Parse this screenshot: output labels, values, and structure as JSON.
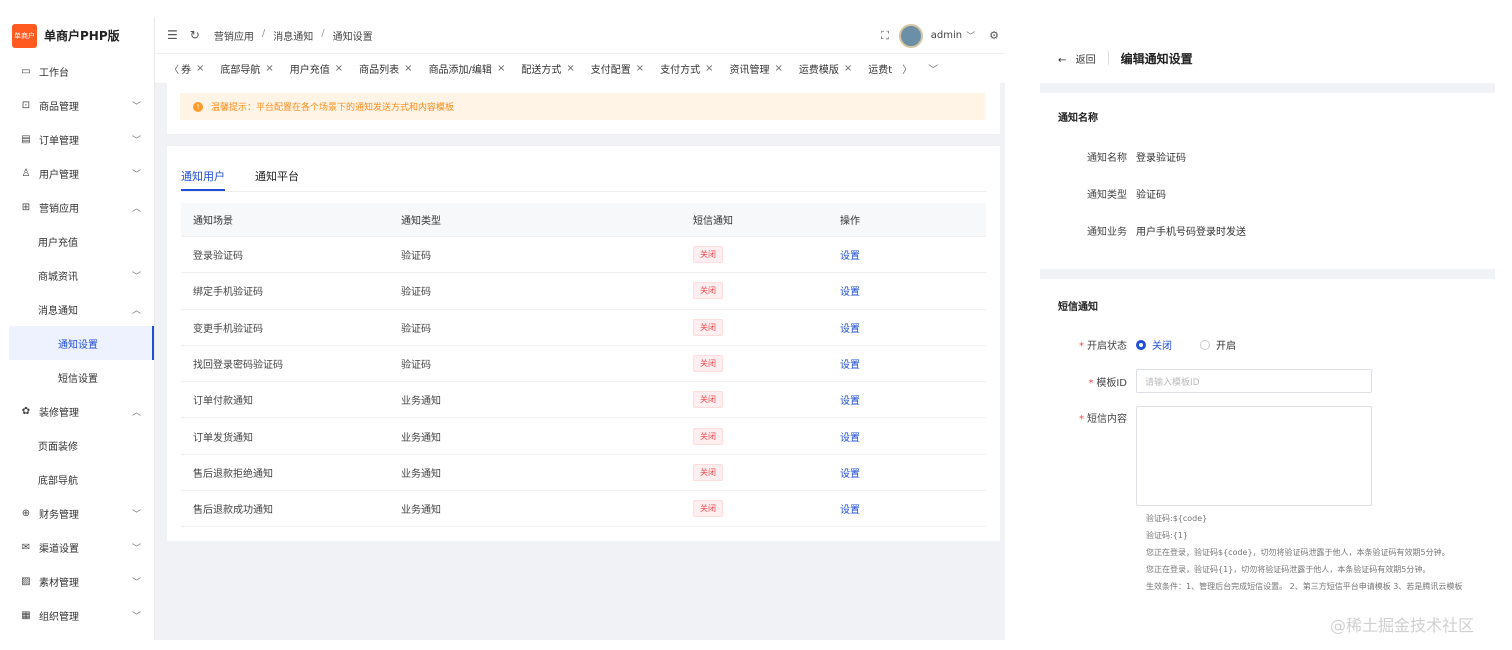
{
  "app": {
    "logo_mark": "单商户",
    "name": "单商户PHP版"
  },
  "sidebar": {
    "items": [
      {
        "label": "工作台",
        "icon": "monitor-icon",
        "glyph": "▭",
        "arrow": ""
      },
      {
        "label": "商品管理",
        "icon": "box-icon",
        "glyph": "⊡",
        "arrow": "﹀"
      },
      {
        "label": "订单管理",
        "icon": "document-icon",
        "glyph": "▤",
        "arrow": "﹀"
      },
      {
        "label": "用户管理",
        "icon": "user-icon",
        "glyph": "♙",
        "arrow": "﹀"
      },
      {
        "label": "营销应用",
        "icon": "marketing-icon",
        "glyph": "⊞",
        "arrow": "︿"
      },
      {
        "label": "用户充值",
        "level": 1
      },
      {
        "label": "商城资讯",
        "level": 1,
        "arrow": "﹀"
      },
      {
        "label": "消息通知",
        "level": 1,
        "arrow": "︿"
      },
      {
        "label": "通知设置",
        "level": 2,
        "active": true
      },
      {
        "label": "短信设置",
        "level": 2
      },
      {
        "label": "装修管理",
        "icon": "decoration-icon",
        "glyph": "✿",
        "arrow": "︿"
      },
      {
        "label": "页面装修",
        "level": 1
      },
      {
        "label": "底部导航",
        "level": 1
      },
      {
        "label": "财务管理",
        "icon": "finance-icon",
        "glyph": "⊕",
        "arrow": "﹀"
      },
      {
        "label": "渠道设置",
        "icon": "mail-icon",
        "glyph": "✉",
        "arrow": "﹀"
      },
      {
        "label": "素材管理",
        "icon": "image-icon",
        "glyph": "▨",
        "arrow": "﹀"
      },
      {
        "label": "组织管理",
        "icon": "org-icon",
        "glyph": "▦",
        "arrow": "﹀"
      }
    ]
  },
  "topbar": {
    "breadcrumb": [
      "营销应用",
      "消息通知",
      "通知设置"
    ],
    "separator": "/",
    "user": "admin",
    "user_caret": "﹀"
  },
  "tabs": {
    "prev": "〈",
    "first_partial": "券",
    "items": [
      "底部导航",
      "用户充值",
      "商品列表",
      "商品添加/编辑",
      "配送方式",
      "支付配置",
      "支付方式",
      "资讯管理",
      "运费模版"
    ],
    "last_partial": "运费t",
    "close": "×",
    "next": "〉",
    "more": "﹀"
  },
  "alert": {
    "icon": "!",
    "text": "温馨提示：平台配置在各个场景下的通知发送方式和内容模板"
  },
  "content_tabs": [
    "通知用户",
    "通知平台"
  ],
  "table": {
    "headers": [
      "通知场景",
      "通知类型",
      "短信通知",
      "操作"
    ],
    "rows": [
      {
        "scene": "登录验证码",
        "type": "验证码",
        "sms": "关闭",
        "action": "设置"
      },
      {
        "scene": "绑定手机验证码",
        "type": "验证码",
        "sms": "关闭",
        "action": "设置"
      },
      {
        "scene": "变更手机验证码",
        "type": "验证码",
        "sms": "关闭",
        "action": "设置"
      },
      {
        "scene": "找回登录密码验证码",
        "type": "验证码",
        "sms": "关闭",
        "action": "设置"
      },
      {
        "scene": "订单付款通知",
        "type": "业务通知",
        "sms": "关闭",
        "action": "设置"
      },
      {
        "scene": "订单发货通知",
        "type": "业务通知",
        "sms": "关闭",
        "action": "设置"
      },
      {
        "scene": "售后退款拒绝通知",
        "type": "业务通知",
        "sms": "关闭",
        "action": "设置"
      },
      {
        "scene": "售后退款成功通知",
        "type": "业务通知",
        "sms": "关闭",
        "action": "设置"
      }
    ]
  },
  "panel": {
    "back_arrow": "←",
    "back": "返回",
    "title": "编辑通知设置",
    "section1_title": "通知名称",
    "fields": [
      {
        "label": "通知名称",
        "value": "登录验证码"
      },
      {
        "label": "通知类型",
        "value": "验证码"
      },
      {
        "label": "通知业务",
        "value": "用户手机号码登录时发送"
      }
    ],
    "section2_title": "短信通知",
    "required_mark": "*",
    "status_label": "开启状态",
    "status_options": [
      "关闭",
      "开启"
    ],
    "template_label": "模板ID",
    "template_placeholder": "请输入模板ID",
    "content_label": "短信内容",
    "hints": [
      "验证码:${code}",
      "验证码:{1}",
      "您正在登录，验证码${code}，切勿将验证码泄露于他人，本条验证码有效期5分钟。",
      "您正在登录，验证码{1}，切勿将验证码泄露于他人，本条验证码有效期5分钟。",
      "生效条件：1、管理后台完成短信设置。 2、第三方短信平台申请模板 3、若是腾讯云模板"
    ]
  },
  "watermark": "@稀土掘金技术社区",
  "colors": {
    "primary": "#1f4fd8",
    "danger": "#f04848",
    "warning": "#ff8c1a",
    "brand": "#ff5a1f"
  }
}
